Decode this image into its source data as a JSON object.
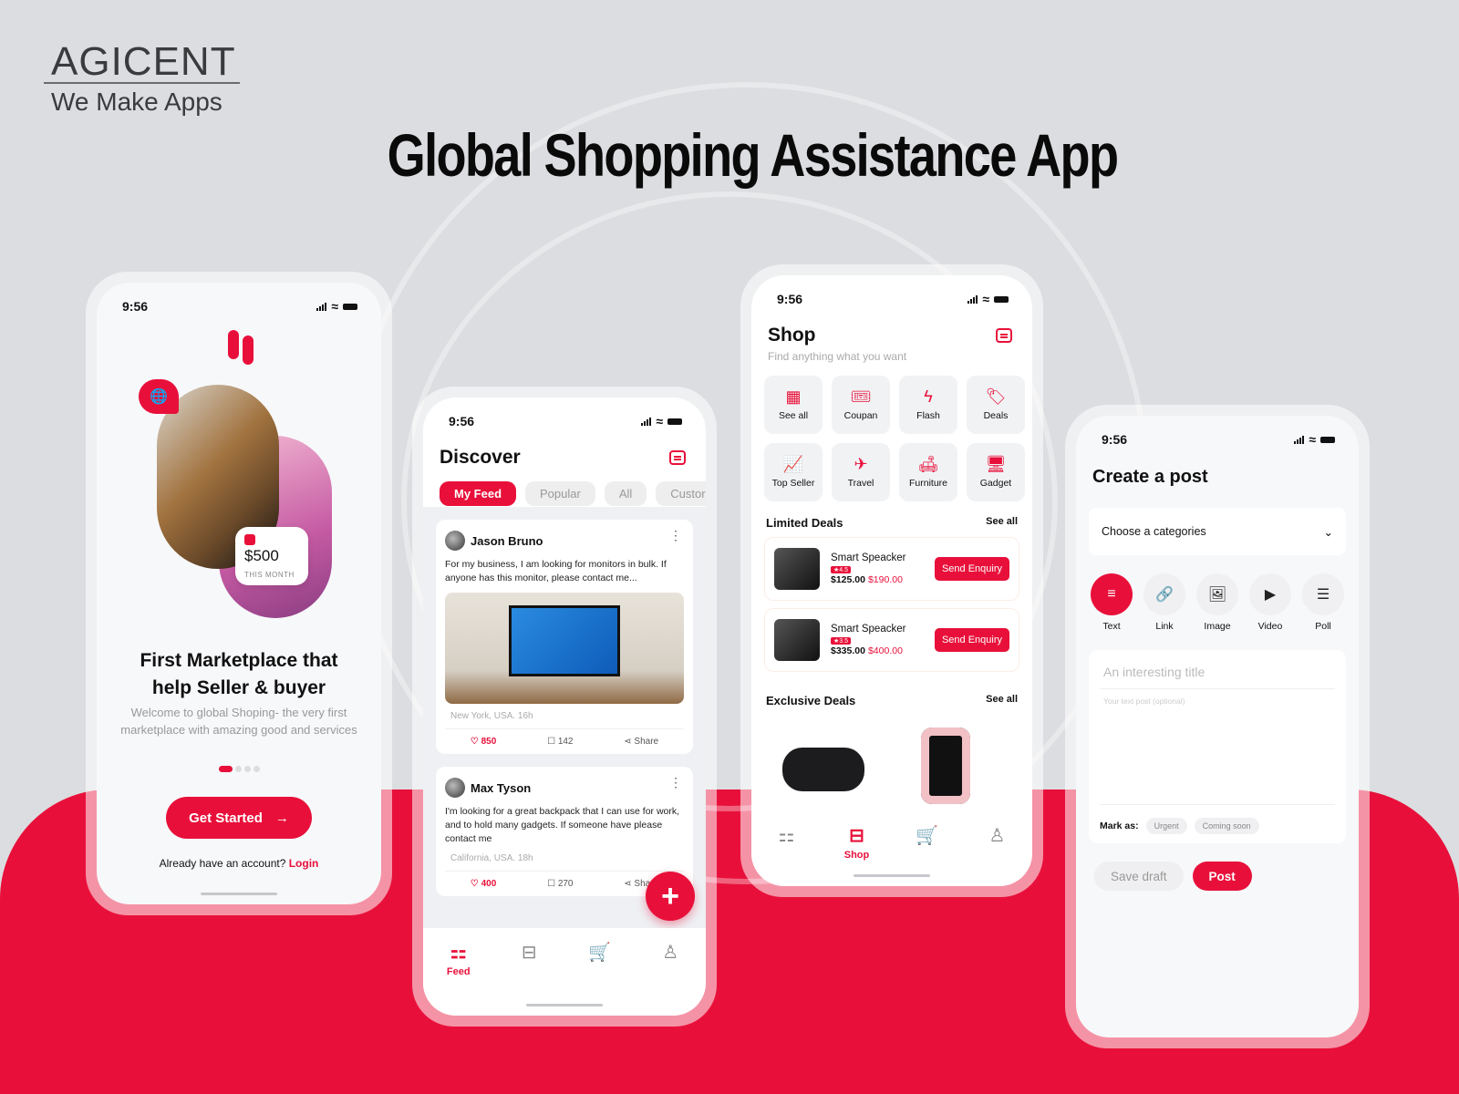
{
  "branding": {
    "company": "AGICENT",
    "tagline": "We Make Apps",
    "headline": "Global Shopping Assistance App"
  },
  "colors": {
    "accent": "#e8103a",
    "background": "#dcdde0"
  },
  "status_bar": {
    "time": "9:56"
  },
  "onboarding": {
    "earning_amount": "$500",
    "earning_period": "THIS MONTH",
    "title": "First Marketplace that help Seller & buyer",
    "description": "Welcome to global Shoping- the very first marketplace with amazing good and services",
    "pager": {
      "pages": 4,
      "active": 1
    },
    "cta_label": "Get Started",
    "login_prompt": "Already have an account?",
    "login_link": "Login"
  },
  "discover": {
    "title": "Discover",
    "tabs": [
      {
        "label": "My Feed",
        "active": true
      },
      {
        "label": "Popular"
      },
      {
        "label": "All"
      },
      {
        "label": "Custor"
      }
    ],
    "posts": [
      {
        "author": "Jason Bruno",
        "text": "For my business, I am looking for monitors in bulk. If anyone has this monitor, please contact me...",
        "location": "New York, USA.  16h",
        "likes": "850",
        "comments": "142",
        "share": "Share"
      },
      {
        "author": "Max Tyson",
        "text": "I'm looking for a great backpack that I can use for work, and to hold many gadgets. If someone have please contact me",
        "location": "California, USA.  18h",
        "likes": "400",
        "comments": "270",
        "share": "Share"
      }
    ],
    "nav": [
      {
        "label": "Feed",
        "icon": "grid-icon",
        "active": true
      },
      {
        "label": "",
        "icon": "shop-icon"
      },
      {
        "label": "",
        "icon": "cart-icon"
      },
      {
        "label": "",
        "icon": "profile-icon"
      }
    ]
  },
  "shop": {
    "title": "Shop",
    "subtitle": "Find anything what you want",
    "categories": [
      {
        "label": "See all",
        "icon": "▦"
      },
      {
        "label": "Coupan",
        "icon": "🎟"
      },
      {
        "label": "Flash",
        "icon": "ϟ"
      },
      {
        "label": "Deals",
        "icon": "🏷"
      },
      {
        "label": "Top Seller",
        "icon": "📈"
      },
      {
        "label": "Travel",
        "icon": "✈"
      },
      {
        "label": "Furniture",
        "icon": "🛋"
      },
      {
        "label": "Gadget",
        "icon": "🖥"
      }
    ],
    "limited_deals": {
      "title": "Limited Deals",
      "see_all": "See all",
      "items": [
        {
          "name": "Smart Speacker",
          "rating": "★4.5",
          "price": "$125.00",
          "old_price": "$190.00",
          "button": "Send Enquiry"
        },
        {
          "name": "Smart Speacker",
          "rating": "★3.5",
          "price": "$335.00",
          "old_price": "$400.00",
          "button": "Send Enquiry"
        }
      ]
    },
    "exclusive_deals": {
      "title": "Exclusive Deals",
      "see_all": "See all"
    },
    "nav": [
      {
        "label": "",
        "icon": "grid-icon"
      },
      {
        "label": "Shop",
        "icon": "shop-icon",
        "active": true
      },
      {
        "label": "",
        "icon": "cart-icon"
      },
      {
        "label": "",
        "icon": "profile-icon"
      }
    ]
  },
  "create_post": {
    "title": "Create a post",
    "category_placeholder": "Choose a categories",
    "types": [
      {
        "label": "Text",
        "icon": "≡",
        "active": true
      },
      {
        "label": "Link",
        "icon": "🔗"
      },
      {
        "label": "Image",
        "icon": "🖼"
      },
      {
        "label": "Video",
        "icon": "▶"
      },
      {
        "label": "Poll",
        "icon": "☰"
      }
    ],
    "title_placeholder": "An interesting title",
    "body_placeholder": "Your text post (optional)",
    "mark_as_label": "Mark as:",
    "marks": [
      "Urgent",
      "Coming soon"
    ],
    "save_draft": "Save draft",
    "post": "Post"
  }
}
